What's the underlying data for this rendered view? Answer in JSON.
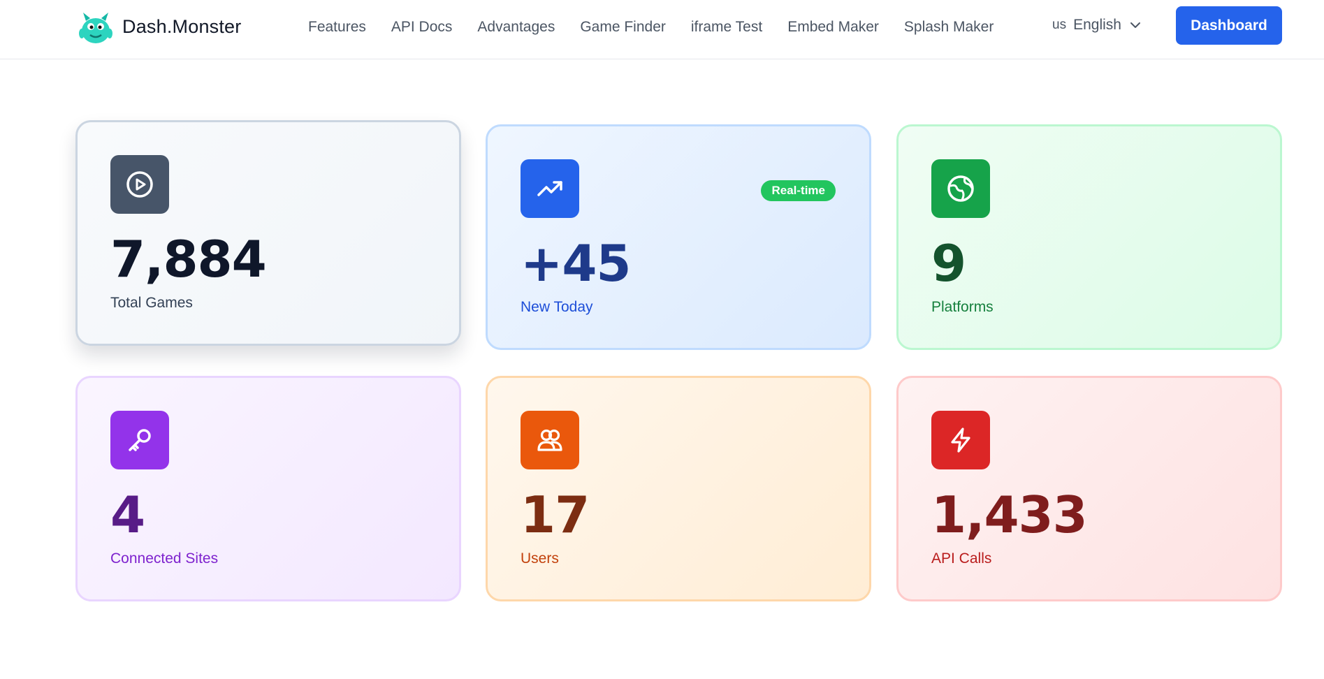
{
  "brand": {
    "name": "Dash.Monster"
  },
  "nav": {
    "links": [
      "Features",
      "API Docs",
      "Advantages",
      "Game Finder",
      "iframe Test",
      "Embed Maker",
      "Splash Maker"
    ],
    "lang_code": "us",
    "lang_label": "English",
    "dashboard_label": "Dashboard"
  },
  "stats": [
    {
      "value": "7,884",
      "label": "Total Games",
      "icon": "play-circle-icon",
      "color": "#475569"
    },
    {
      "value": "+45",
      "label": "New Today",
      "icon": "trending-up-icon",
      "color": "#2563eb",
      "badge": "Real-time"
    },
    {
      "value": "9",
      "label": "Platforms",
      "icon": "globe-icon",
      "color": "#16a34a"
    },
    {
      "value": "4",
      "label": "Connected Sites",
      "icon": "key-icon",
      "color": "#9333ea"
    },
    {
      "value": "17",
      "label": "Users",
      "icon": "users-icon",
      "color": "#ea580c"
    },
    {
      "value": "1,433",
      "label": "API Calls",
      "icon": "lightning-icon",
      "color": "#dc2626"
    }
  ]
}
